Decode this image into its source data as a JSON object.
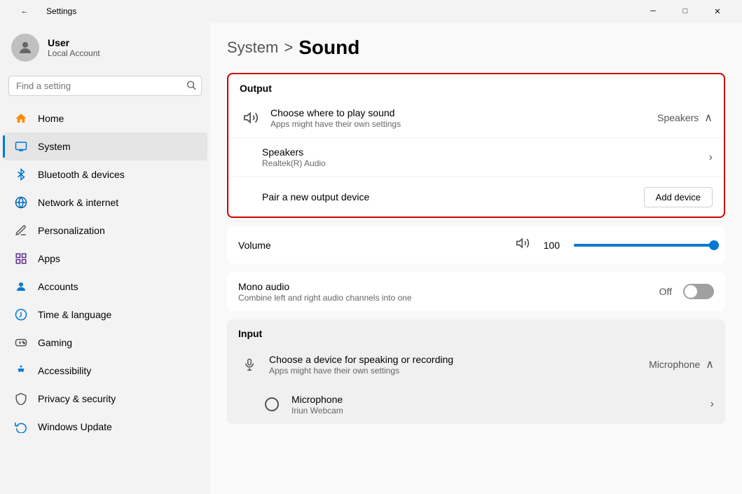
{
  "titlebar": {
    "back_icon": "←",
    "title": "Settings",
    "min_label": "─",
    "max_label": "□",
    "close_label": "✕"
  },
  "sidebar": {
    "user": {
      "name": "User",
      "account_type": "Local Account",
      "avatar_icon": "👤"
    },
    "search": {
      "placeholder": "Find a setting",
      "icon": "🔍"
    },
    "nav_items": [
      {
        "id": "home",
        "label": "Home",
        "icon": "🏠",
        "active": false,
        "color": "#ff8c00"
      },
      {
        "id": "system",
        "label": "System",
        "icon": "💻",
        "active": true,
        "color": "#0078d4"
      },
      {
        "id": "bluetooth",
        "label": "Bluetooth & devices",
        "icon": "🔵",
        "active": false,
        "color": "#0078d4"
      },
      {
        "id": "network",
        "label": "Network & internet",
        "icon": "🌐",
        "active": false,
        "color": "#0067c0"
      },
      {
        "id": "personalization",
        "label": "Personalization",
        "icon": "✏️",
        "active": false,
        "color": "#555"
      },
      {
        "id": "apps",
        "label": "Apps",
        "icon": "📦",
        "active": false,
        "color": "#5c2d91"
      },
      {
        "id": "accounts",
        "label": "Accounts",
        "icon": "👤",
        "active": false,
        "color": "#0078d4"
      },
      {
        "id": "time",
        "label": "Time & language",
        "icon": "🌍",
        "active": false,
        "color": "#0078d4"
      },
      {
        "id": "gaming",
        "label": "Gaming",
        "icon": "🎮",
        "active": false,
        "color": "#555"
      },
      {
        "id": "accessibility",
        "label": "Accessibility",
        "icon": "♿",
        "active": false,
        "color": "#0078d4"
      },
      {
        "id": "privacy",
        "label": "Privacy & security",
        "icon": "🛡️",
        "active": false,
        "color": "#555"
      },
      {
        "id": "update",
        "label": "Windows Update",
        "icon": "🔄",
        "active": false,
        "color": "#0078d4"
      }
    ]
  },
  "main": {
    "breadcrumb_parent": "System",
    "breadcrumb_sep": ">",
    "breadcrumb_current": "Sound",
    "output_section": {
      "label": "Output",
      "choose_sound_title": "Choose where to play sound",
      "choose_sound_subtitle": "Apps might have their own settings",
      "choose_sound_value": "Speakers",
      "speakers_title": "Speakers",
      "speakers_subtitle": "Realtek(R) Audio",
      "pair_device_label": "Pair a new output device",
      "add_device_btn": "Add device"
    },
    "volume_section": {
      "label": "Volume",
      "icon": "🔊",
      "value": "100",
      "slider_fill": 100
    },
    "mono_audio": {
      "title": "Mono audio",
      "subtitle": "Combine left and right audio channels into one",
      "toggle_state": "Off"
    },
    "input_section": {
      "label": "Input",
      "choose_device_title": "Choose a device for speaking or recording",
      "choose_device_subtitle": "Apps might have their own settings",
      "choose_device_value": "Microphone",
      "microphone_title": "Microphone",
      "microphone_subtitle": "Iriun Webcam"
    }
  }
}
